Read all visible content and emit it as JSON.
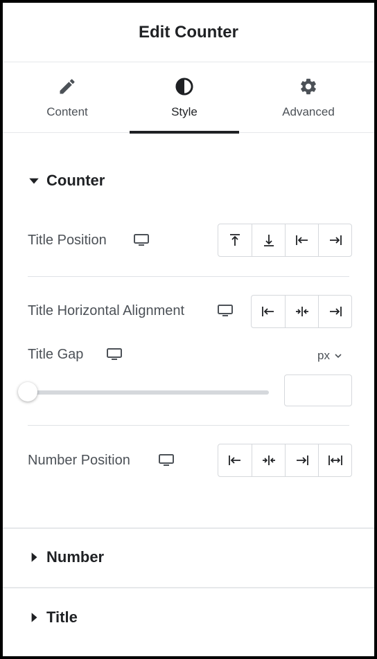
{
  "header": {
    "title": "Edit Counter"
  },
  "tabs": [
    {
      "label": "Content",
      "icon": "pencil-icon",
      "active": false
    },
    {
      "label": "Style",
      "icon": "half-circle-icon",
      "active": true
    },
    {
      "label": "Advanced",
      "icon": "gear-icon",
      "active": false
    }
  ],
  "sections": {
    "counter": {
      "title": "Counter",
      "expanded": true,
      "title_position": {
        "label": "Title Position",
        "device_icon": "desktop-icon",
        "options": [
          "align-top-icon",
          "align-bottom-icon",
          "align-start-icon",
          "align-end-icon"
        ]
      },
      "title_horizontal_alignment": {
        "label": "Title Horizontal Alignment",
        "device_icon": "desktop-icon",
        "options": [
          "align-start-icon",
          "align-center-icon",
          "align-end-icon"
        ]
      },
      "title_gap": {
        "label": "Title Gap",
        "device_icon": "desktop-icon",
        "unit": "px",
        "value": "",
        "slider_fraction": 0
      },
      "number_position": {
        "label": "Number Position",
        "device_icon": "desktop-icon",
        "options": [
          "align-start-icon",
          "align-center-icon",
          "align-end-icon",
          "align-stretch-icon"
        ]
      }
    },
    "number": {
      "title": "Number",
      "expanded": false
    },
    "title": {
      "title": "Title",
      "expanded": false
    }
  },
  "colors": {
    "text_dark": "#1f2124",
    "text_muted": "#4c5157",
    "border": "#d5d8dc",
    "active_underline": "#1f2124"
  }
}
